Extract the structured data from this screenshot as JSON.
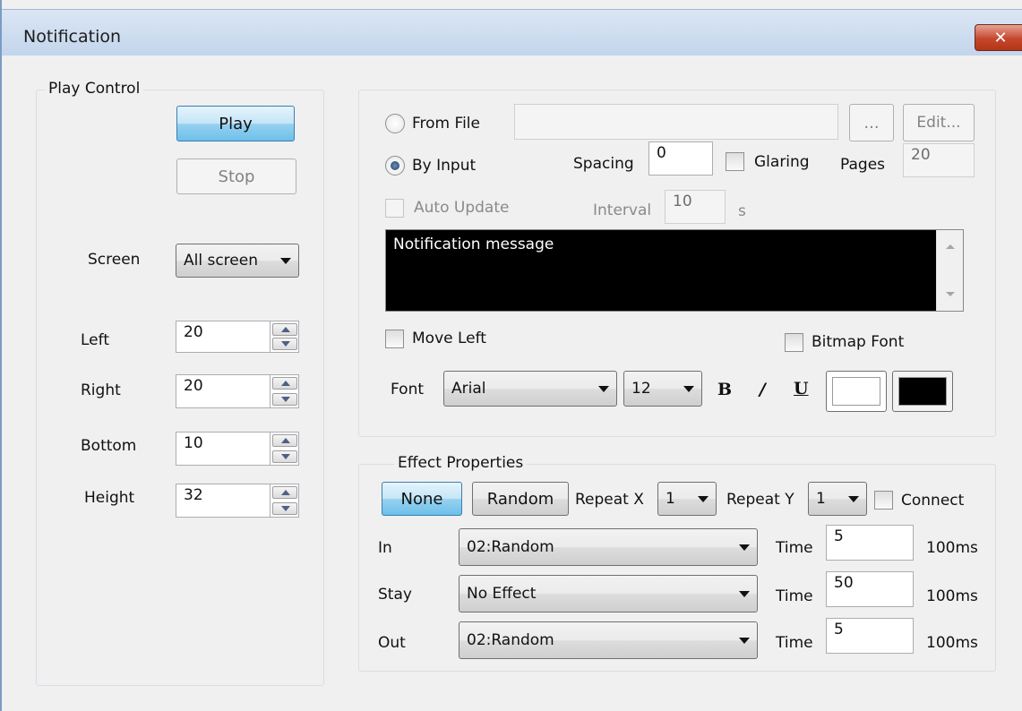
{
  "window": {
    "title": "Notification",
    "close_glyph": "✕"
  },
  "play_control": {
    "group_label": "Play Control",
    "play_label": "Play",
    "stop_label": "Stop",
    "screen_label": "Screen",
    "screen_value": "All screen",
    "left_label": "Left",
    "left_value": "20",
    "right_label": "Right",
    "right_value": "20",
    "bottom_label": "Bottom",
    "bottom_value": "10",
    "height_label": "Height",
    "height_value": "32"
  },
  "source": {
    "from_file_label": "From File",
    "file_path": "",
    "browse_label": "...",
    "edit_label": "Edit...",
    "by_input_label": "By Input",
    "spacing_label": "Spacing",
    "spacing_value": "0",
    "glaring_label": "Glaring",
    "pages_label": "Pages",
    "pages_value": "20",
    "auto_update_label": "Auto Update",
    "interval_label": "Interval",
    "interval_value": "10",
    "interval_unit": "s",
    "message": "Notification message",
    "move_left_label": "Move Left",
    "bitmap_font_label": "Bitmap Font",
    "font_label": "Font",
    "font_value": "Arial",
    "font_size_value": "12",
    "bold_glyph": "B",
    "italic_glyph": "/",
    "underline_glyph": "U",
    "fore_color": "#ffffff",
    "back_color": "#000000"
  },
  "effect": {
    "group_label": "Effect Properties",
    "none_label": "None",
    "random_label": "Random",
    "repeat_x_label": "Repeat X",
    "repeat_x_value": "1",
    "repeat_y_label": "Repeat Y",
    "repeat_y_value": "1",
    "connect_label": "Connect",
    "rows": [
      {
        "label": "In",
        "effect": "02:Random",
        "time_label": "Time",
        "time": "5",
        "unit": "100ms"
      },
      {
        "label": "Stay",
        "effect": "No Effect",
        "time_label": "Time",
        "time": "50",
        "unit": "100ms"
      },
      {
        "label": "Out",
        "effect": "02:Random",
        "time_label": "Time",
        "time": "5",
        "unit": "100ms"
      }
    ]
  }
}
